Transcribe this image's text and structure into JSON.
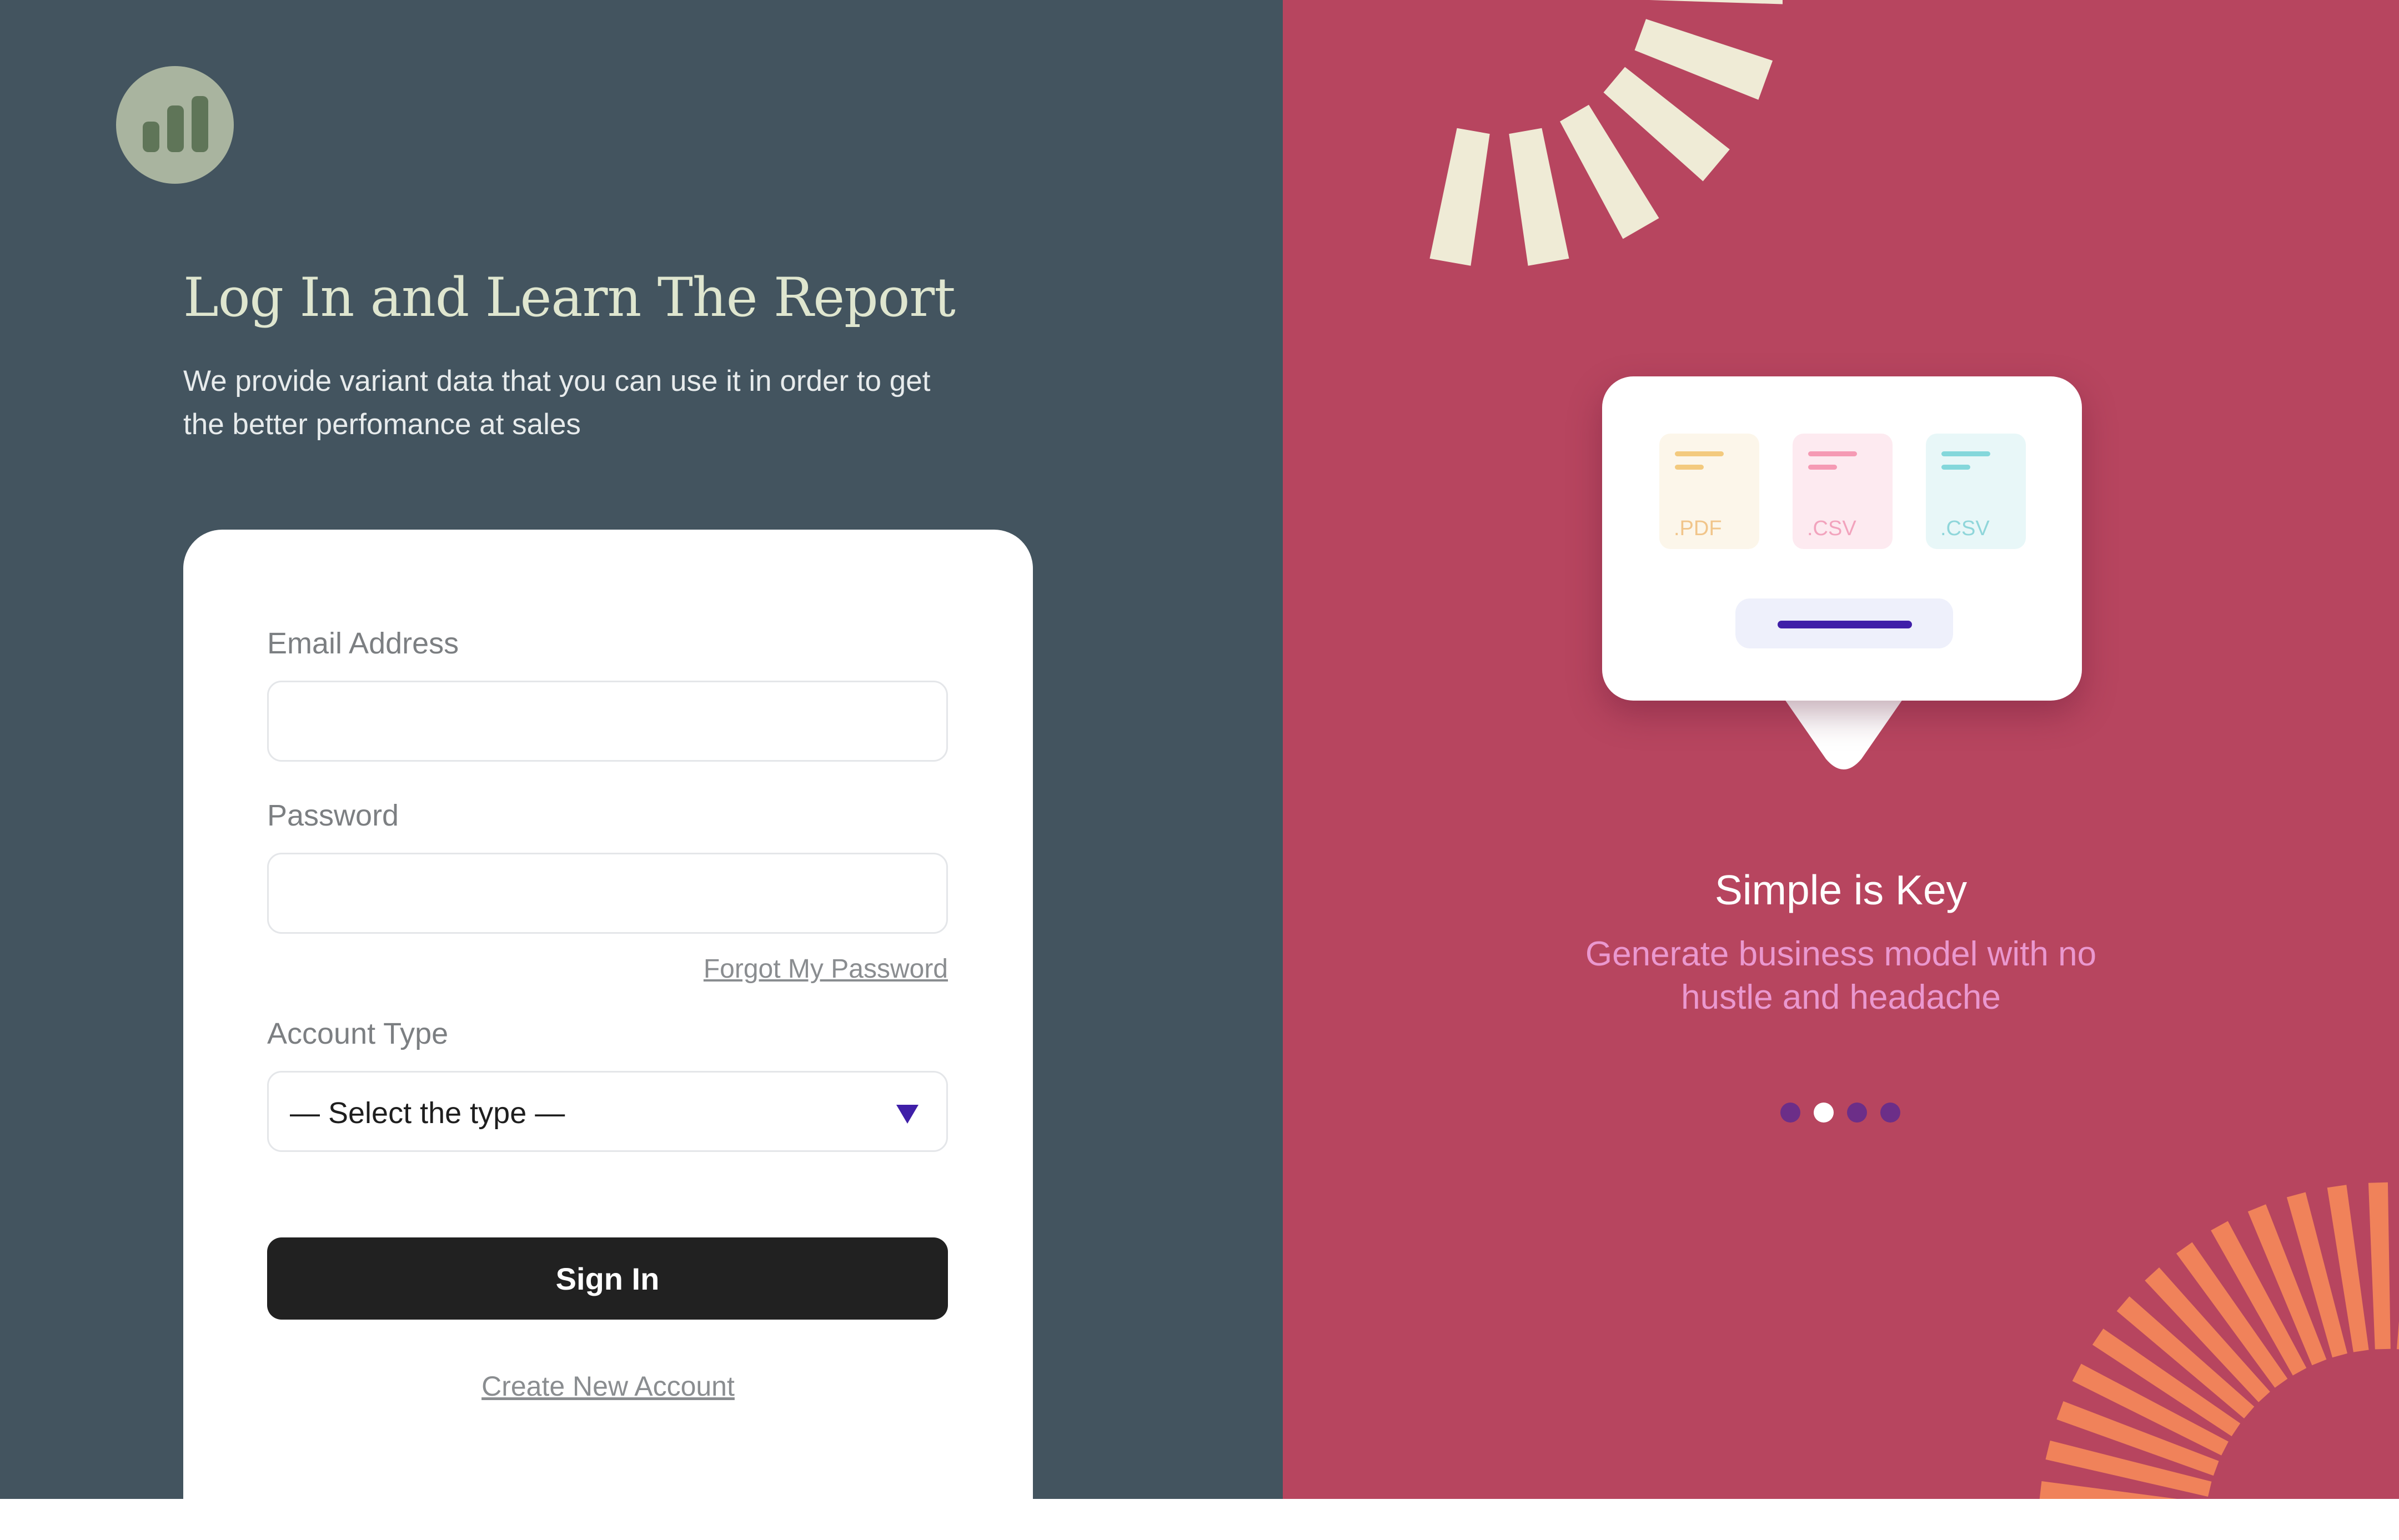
{
  "brand": {
    "logo_icon": "bar-chart-icon"
  },
  "intro": {
    "title": "Log In and Learn The Report",
    "subtitle": "We provide variant data that you can use it in order to get the better perfomance at sales"
  },
  "login_form": {
    "email": {
      "label": "Email Address",
      "value": "",
      "placeholder": ""
    },
    "password": {
      "label": "Password",
      "value": "",
      "placeholder": ""
    },
    "forgot_link": "Forgot My Password",
    "account_type": {
      "label": "Account Type",
      "selected": "— Select the type —",
      "arrow_icon": "triangle-down-icon"
    },
    "sign_in_label": "Sign In",
    "create_account_link": "Create New Account"
  },
  "feature": {
    "files": [
      {
        "ext": ".PDF",
        "icon": "pdf-file-icon"
      },
      {
        "ext": ".CSV",
        "icon": "csv-file-icon"
      },
      {
        "ext": ".CSV",
        "icon": "csv-file-icon"
      }
    ],
    "title": "Simple is Key",
    "description": "Generate business model with no hustle and headache"
  },
  "carousel": {
    "total": 4,
    "active": 2
  },
  "colors": {
    "left_background": "#43545f",
    "right_background": "#b7455f",
    "accent": "#3f1fa8",
    "sign_in_button": "#212121",
    "top_rays": "#efebd6",
    "bottom_rays": "#f0825a"
  }
}
